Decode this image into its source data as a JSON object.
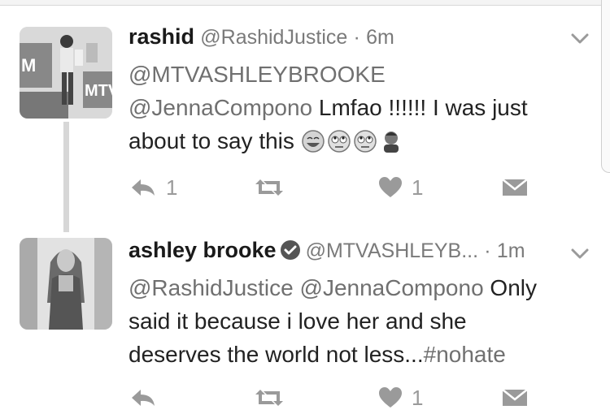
{
  "tweets": [
    {
      "name": "rashid",
      "handle": "@RashidJustice",
      "dot": "·",
      "time": "6m",
      "mention1": "@MTVASHLEYBROOKE",
      "mention2": "@JennaCompono",
      "text1": " Lmfao !!!!!! I was just",
      "text2": "about to say this ",
      "emojis": [
        "laughing-emoji",
        "rolling-eyes-emoji",
        "rolling-eyes-emoji",
        "person-emoji"
      ],
      "reply_count": "1",
      "retweet_count": "",
      "like_count": "1"
    },
    {
      "name": "ashley brooke",
      "verified": true,
      "handle": "@MTVASHLEYB...",
      "dot": "·",
      "time": "1m",
      "mention1": "@RashidJustice",
      "mention2": "@JennaCompono",
      "text1": " Only",
      "text2": "said it because i love her and she",
      "text3": "deserves the world not less...",
      "hashtag": "#nohate",
      "reply_count": "",
      "retweet_count": "",
      "like_count": "1"
    }
  ],
  "colors": {
    "text": "#222222",
    "meta": "#7a7a7a",
    "icon": "#9a9a9a",
    "thread_line": "#d7d7d7"
  }
}
